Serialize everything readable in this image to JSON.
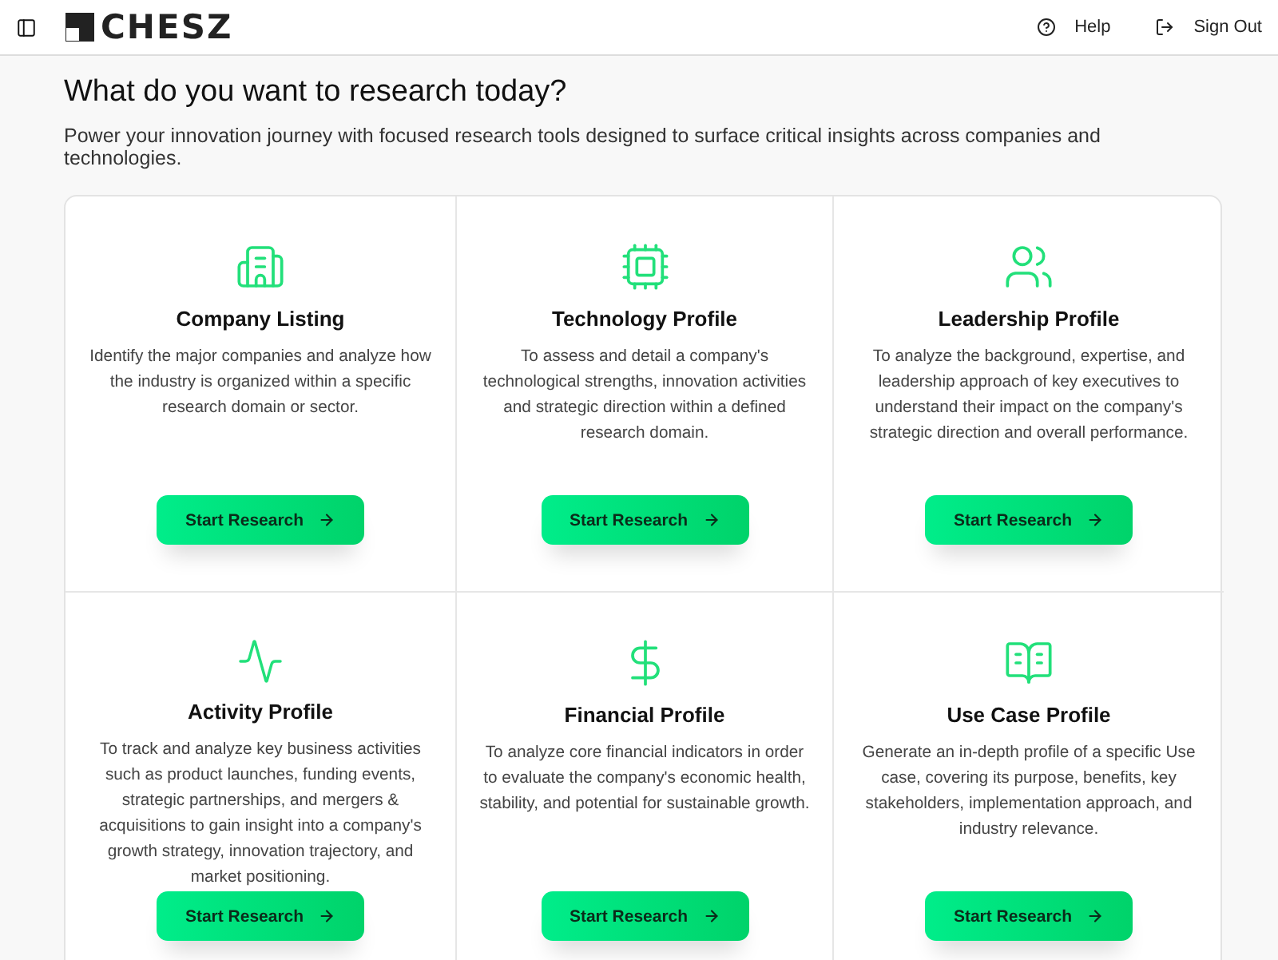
{
  "header": {
    "logo": "CHESZ",
    "actions": [
      {
        "label": "Help"
      },
      {
        "label": "Sign Out"
      }
    ]
  },
  "heading": "What do you want to research today?",
  "subheading": "Power your innovation journey with focused research tools designed to surface critical insights across companies and technologies.",
  "cards": [
    {
      "title": "Company Listing",
      "description": "Identify the major companies and analyze how the industry is organized within a specific research domain or sector.",
      "button": "Start Research"
    },
    {
      "title": "Technology Profile",
      "description": "To assess and detail a company's technological strengths, innovation activities and strategic direction within a defined research domain.",
      "button": "Start Research"
    },
    {
      "title": "Leadership Profile",
      "description": "To analyze the background, expertise, and leadership approach of key executives to understand their impact on the company's strategic direction and overall performance.",
      "button": "Start Research"
    },
    {
      "title": "Activity Profile",
      "description": "To track and analyze key business activities such as product launches, funding events, strategic partnerships, and mergers & acquisitions to gain insight into a company's growth strategy, innovation trajectory, and market positioning.",
      "button": "Start Research"
    },
    {
      "title": "Financial Profile",
      "description": "To analyze core financial indicators in order to evaluate the company's economic health, stability, and potential for sustainable growth.",
      "button": "Start Research"
    },
    {
      "title": "Use Case Profile",
      "description": "Generate an in-depth profile of a specific Use case, covering its purpose, benefits, key stakeholders, implementation approach, and industry relevance.",
      "button": "Start Research"
    }
  ]
}
